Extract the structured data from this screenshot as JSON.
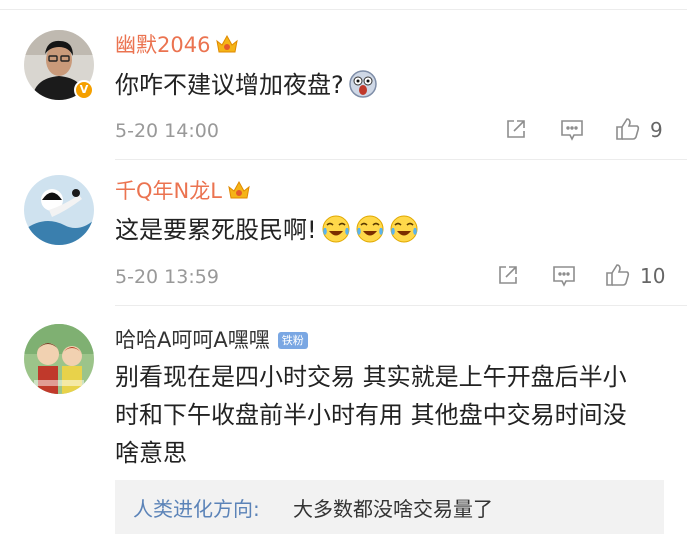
{
  "comments": [
    {
      "username": "幽默2046",
      "text": "你咋不建议增加夜盘?",
      "time": "5-20 14:00",
      "likes": "9",
      "verified_badge": "V",
      "emoji": "shocked-face-emoji"
    },
    {
      "username": "千Q年N龙L",
      "text": "这是要累死股民啊!",
      "time": "5-20 13:59",
      "likes": "10",
      "emoji": "laughing-tears-emoji"
    },
    {
      "username": "哈哈A呵呵A嘿嘿",
      "badge": "铁粉",
      "text_lines": [
        "别看现在是四小时交易 其实就是上午开盘后半小",
        "时和下午收盘前半小时有用 其他盘中交易时间没",
        "啥意思"
      ],
      "reply": {
        "username": "人类进化方向:",
        "text": "大多数都没啥交易量了"
      }
    }
  ],
  "colors": {
    "vip_name": "#eb7350",
    "reply_name": "#5b83b8",
    "badge_bg": "#7aa7e3",
    "meta_gray": "#999999"
  }
}
